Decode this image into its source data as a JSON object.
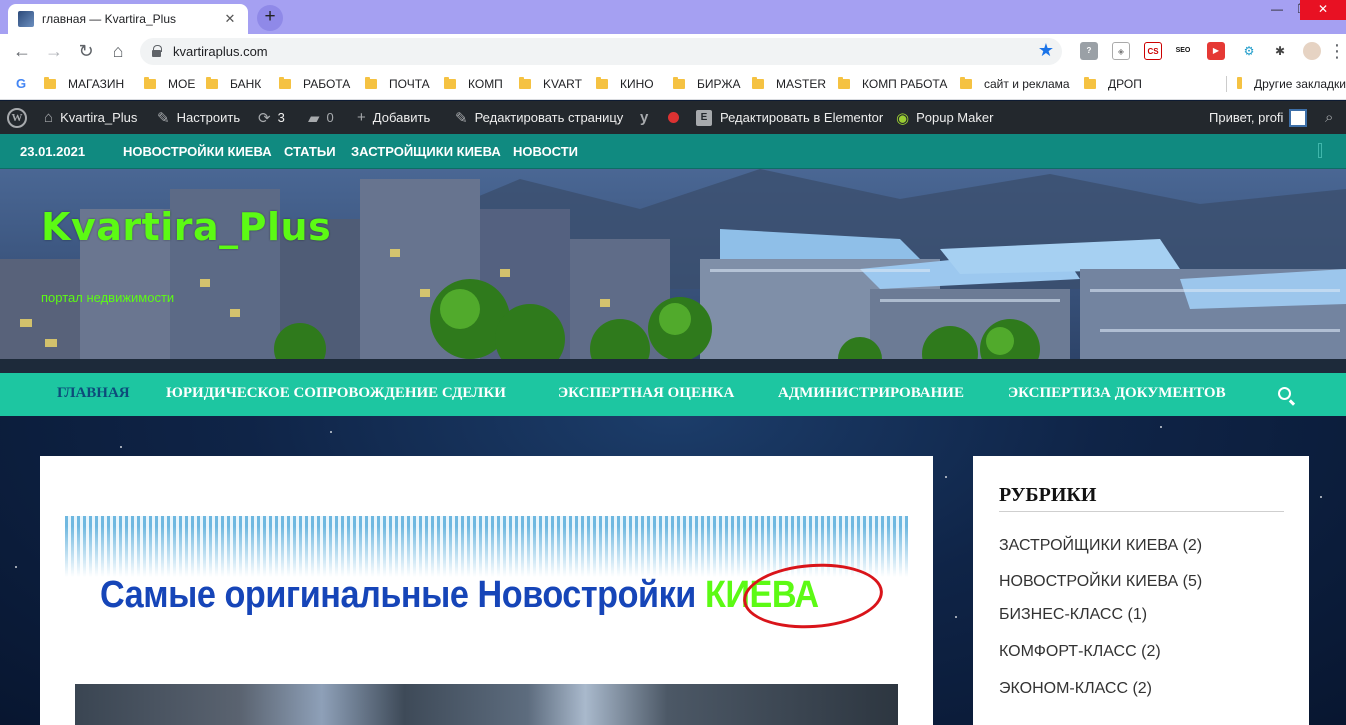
{
  "browser": {
    "tab_title": "главная — Kvartira_Plus",
    "tab_close": "✕",
    "new_tab": "+",
    "url": "kvartiraplus.com",
    "window_controls": [
      "—",
      "❐",
      "✕"
    ],
    "bookmarks": [
      "МАГАЗИН",
      "МОЕ",
      "БАНК",
      "РАБОТА",
      "ПОЧТА",
      "КОМП",
      "KVART",
      "КИНО",
      "БИРЖА",
      "MASTER",
      "КОМП РАБОТА",
      "сайт и реклама",
      "ДРОП",
      "Другие закладки"
    ],
    "extensions": [
      "?",
      "◈",
      "CS",
      "SEO",
      "▶",
      "⚙",
      "✱",
      "●"
    ]
  },
  "admin_bar": {
    "site": "Kvartira_Plus",
    "customize": "Настроить",
    "updates": "3",
    "comments": "0",
    "add": "Добавить",
    "edit_page": "Редактировать страницу",
    "elementor": "Редактировать в Elementor",
    "popup": "Popup Maker",
    "greeting": "Привет, profi"
  },
  "top_bar": {
    "date": "23.01.2021",
    "links": [
      "НОВОСТРОЙКИ КИЕВА",
      "СТАТЬИ",
      "ЗАСТРОЙЩИКИ КИЕВА",
      "НОВОСТИ"
    ]
  },
  "header": {
    "title": "Kvartira_Plus",
    "tagline": "портал недвижимости"
  },
  "main_nav": {
    "items": [
      "ГЛАВНАЯ",
      "ЮРИДИЧЕСКОЕ СОПРОВОЖДЕНИЕ СДЕЛКИ",
      "ЭКСПЕРТНАЯ ОЦЕНКА",
      "АДМИНИСТРИРОВАНИЕ",
      "ЭКСПЕРТИЗА ДОКУМЕНТОВ"
    ],
    "active": 0
  },
  "content": {
    "headline_main": "Самые оригинальные Новостройки",
    "headline_accent": "КИЕВА"
  },
  "sidebar": {
    "title": "РУБРИКИ",
    "items": [
      {
        "label": "ЗАСТРОЙЩИКИ КИЕВА",
        "count": "(2)"
      },
      {
        "label": "НОВОСТРОЙКИ КИЕВА",
        "count": "(5)"
      },
      {
        "label": "БИЗНЕС-КЛАСС",
        "count": "(1)"
      },
      {
        "label": "КОМФОРТ-КЛАСС",
        "count": "(2)"
      },
      {
        "label": "ЭКОНОМ-КЛАСС",
        "count": "(2)"
      }
    ]
  },
  "colors": {
    "accent_green": "#5cfa14",
    "teal_bar": "#108a80",
    "nav_mint": "#1dc6a1",
    "headline_blue": "#1645b8"
  }
}
